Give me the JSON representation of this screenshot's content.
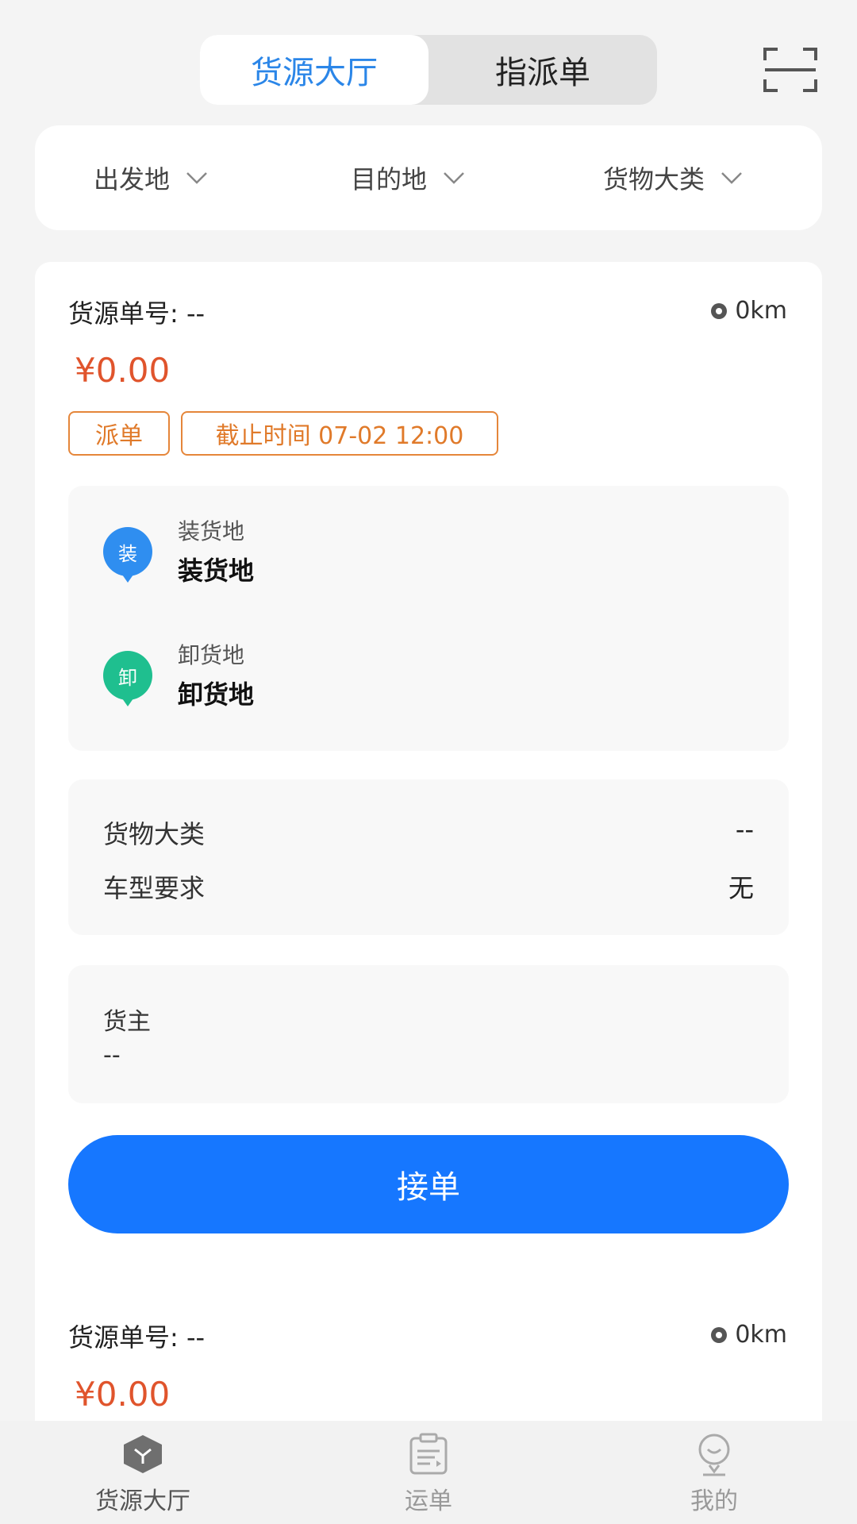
{
  "top_tabs": [
    {
      "label": "货源大厅",
      "active": true
    },
    {
      "label": "指派单",
      "active": false
    }
  ],
  "filters": [
    {
      "label": "出发地"
    },
    {
      "label": "目的地"
    },
    {
      "label": "货物大类"
    }
  ],
  "orders": [
    {
      "id_label": "货源单号: --",
      "distance": "0km",
      "price": "¥0.00",
      "tags": [
        "派单",
        "截止时间 07-02 12:00"
      ],
      "load": {
        "icon_text": "装",
        "label": "装货地",
        "value": "装货地"
      },
      "unload": {
        "icon_text": "卸",
        "label": "卸货地",
        "value": "卸货地"
      },
      "cargo_category": {
        "key": "货物大类",
        "value": "--"
      },
      "vehicle_requirement": {
        "key": "车型要求",
        "value": "无"
      },
      "shipper": {
        "key": "货主",
        "value": "--"
      },
      "accept_label": "接单"
    },
    {
      "id_label": "货源单号: --",
      "distance": "0km",
      "price": "¥0.00"
    }
  ],
  "bottom_nav": [
    {
      "label": "货源大厅",
      "icon": "cube-icon",
      "active": true
    },
    {
      "label": "运单",
      "icon": "clipboard-icon",
      "active": false
    },
    {
      "label": "我的",
      "icon": "person-icon",
      "active": false
    }
  ],
  "colors": {
    "accent_blue": "#1677ff",
    "tab_active_text": "#2b86e8",
    "price_red": "#e0542c",
    "tag_orange": "#e07a2a",
    "load_icon_blue": "#2f8ef0",
    "unload_icon_green": "#1fbf8f"
  }
}
